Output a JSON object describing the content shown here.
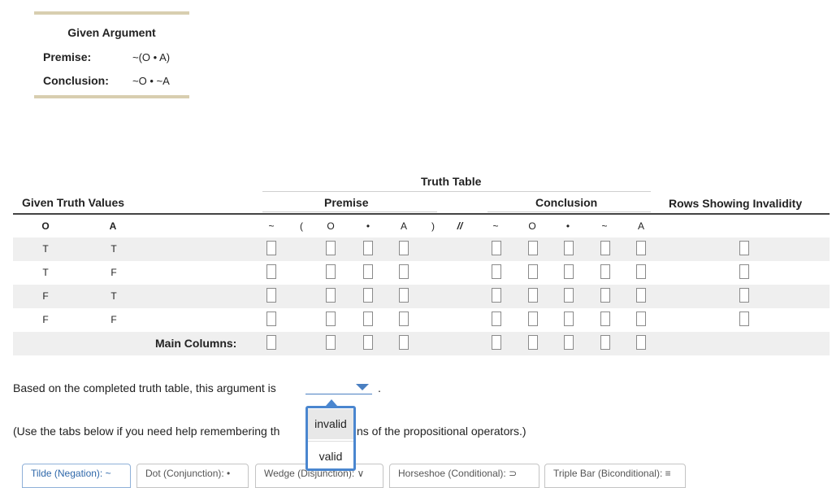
{
  "argument": {
    "title": "Given Argument",
    "premise_label": "Premise:",
    "premise": "~(O • A)",
    "conclusion_label": "Conclusion:",
    "conclusion": "~O • ~A"
  },
  "table": {
    "title": "Truth Table",
    "given_header": "Given Truth Values",
    "premise_header": "Premise",
    "conclusion_header": "Conclusion",
    "rows_header": "Rows Showing Invalidity",
    "var_headers": [
      "O",
      "A"
    ],
    "premise_symbols": [
      "~",
      "(",
      "O",
      "•",
      "A",
      ")"
    ],
    "separator": "//",
    "conclusion_symbols": [
      "~",
      "O",
      "•",
      "~",
      "A"
    ],
    "rows": [
      [
        "T",
        "T"
      ],
      [
        "T",
        "F"
      ],
      [
        "F",
        "T"
      ],
      [
        "F",
        "F"
      ]
    ],
    "main_columns_label": "Main Columns:"
  },
  "question": {
    "prefix": "Based on the completed truth table, this argument is",
    "suffix": ".",
    "options": [
      "invalid",
      "valid"
    ],
    "hint_before": "(Use the tabs below if you need help remembering th",
    "hint_after": "ns of the propositional operators.)"
  },
  "tabs": [
    "Tilde (Negation): ~",
    "Dot (Conjunction): •",
    "Wedge (Disjunction): ∨",
    "Horseshoe (Conditional): ⊃",
    "Triple Bar (Biconditional): ≡"
  ],
  "colors": {
    "accent": "#4a86cf",
    "box_border": "#d8ceb0",
    "row_shade": "#efefef"
  }
}
